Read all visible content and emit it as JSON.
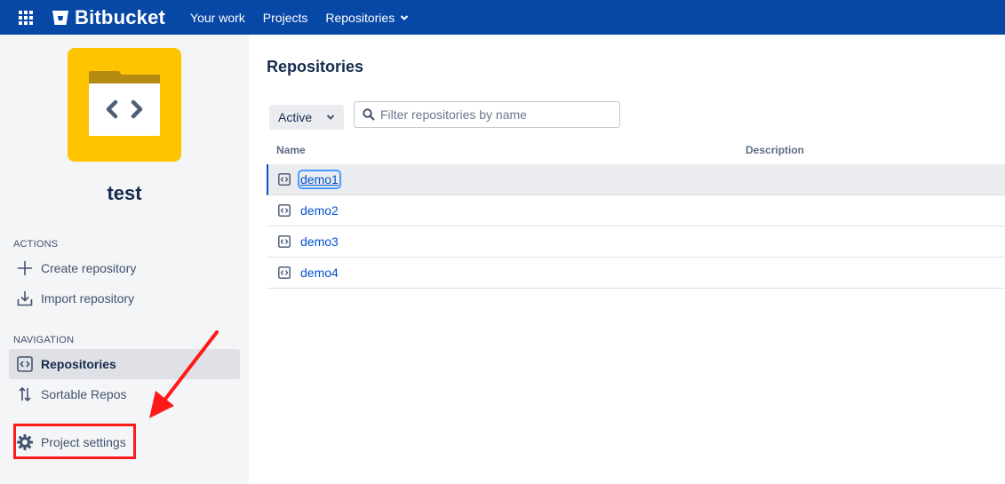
{
  "header": {
    "brand": "Bitbucket",
    "nav": [
      {
        "label": "Your work"
      },
      {
        "label": "Projects"
      },
      {
        "label": "Repositories"
      }
    ]
  },
  "sidebar": {
    "project_name": "test",
    "actions_label": "ACTIONS",
    "actions": [
      {
        "label": "Create repository",
        "icon": "plus-icon"
      },
      {
        "label": "Import repository",
        "icon": "import-icon"
      }
    ],
    "navigation_label": "NAVIGATION",
    "navigation": [
      {
        "label": "Repositories",
        "icon": "code-icon",
        "active": true
      },
      {
        "label": "Sortable Repos",
        "icon": "sort-icon",
        "active": false
      }
    ],
    "settings": {
      "label": "Project settings",
      "icon": "gear-icon"
    }
  },
  "main": {
    "title": "Repositories",
    "filter": {
      "selected": "Active"
    },
    "search": {
      "placeholder": "Filter repositories by name"
    },
    "columns": [
      "Name",
      "Description"
    ],
    "repos": [
      {
        "name": "demo1",
        "description": "",
        "selected": true
      },
      {
        "name": "demo2",
        "description": ""
      },
      {
        "name": "demo3",
        "description": ""
      },
      {
        "name": "demo4",
        "description": ""
      }
    ]
  },
  "colors": {
    "topbar": "#0747a6",
    "link": "#0052cc",
    "avatar": "#ffc400",
    "highlight": "#ff1a1a"
  }
}
